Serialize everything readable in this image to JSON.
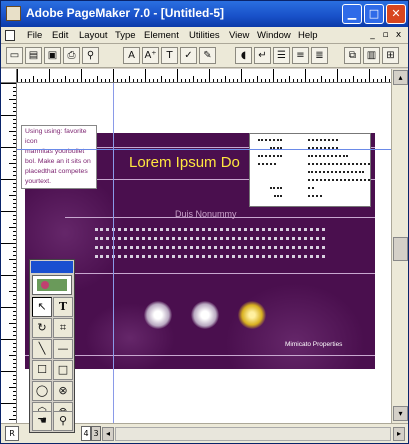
{
  "window": {
    "title": "Adobe PageMaker 7.0 - [Untitled-5]",
    "minimize_glyph": "▁",
    "maximize_glyph": "□",
    "close_glyph": "✕"
  },
  "menu": {
    "items": [
      "File",
      "Edit",
      "Layout",
      "Type",
      "Element",
      "Utilities",
      "View",
      "Window",
      "Help"
    ],
    "mdi": {
      "minimize": "_",
      "restore": "▫",
      "close": "x"
    }
  },
  "toolbar": {
    "buttons": [
      {
        "name": "new-icon",
        "glyph": "▭"
      },
      {
        "name": "open-icon",
        "glyph": "▤"
      },
      {
        "name": "save-icon",
        "glyph": "▣"
      },
      {
        "name": "print-icon",
        "glyph": "⎙"
      },
      {
        "name": "find-icon",
        "glyph": "⚲"
      },
      {
        "name": "char-spec-icon",
        "glyph": "A"
      },
      {
        "name": "font-size-up-icon",
        "glyph": "A⁺"
      },
      {
        "name": "kerning-icon",
        "glyph": "T"
      },
      {
        "name": "spell-check-icon",
        "glyph": "✓"
      },
      {
        "name": "edit-icon",
        "glyph": "✎"
      },
      {
        "name": "para-icon",
        "glyph": "◖"
      },
      {
        "name": "indents-icon",
        "glyph": "↵"
      },
      {
        "name": "bullets-icon",
        "glyph": "☰"
      },
      {
        "name": "list-icon",
        "glyph": "≡"
      },
      {
        "name": "align-icon",
        "glyph": "≣"
      },
      {
        "name": "copy-icon",
        "glyph": "⧉"
      },
      {
        "name": "paste-icon",
        "glyph": "▥"
      },
      {
        "name": "insert-icon",
        "glyph": "⊞"
      }
    ]
  },
  "document": {
    "textbox_lines": [
      "Using using: favorite icon",
      "marmitas yourbullet",
      "bol. Make an it sits on",
      "placedthat competes",
      "yourtext."
    ],
    "headline": "Lorem Ipsum Do",
    "subhead": "Duis Nonummy",
    "footer_label": "Mimicato Properties"
  },
  "bottombar": {
    "pages": [
      "R",
      "4",
      "3"
    ],
    "scroll_left": "◂",
    "scroll_right": "▸"
  },
  "vscroll": {
    "up": "▴",
    "down": "▾"
  },
  "toolbox": {
    "tools": [
      {
        "name": "pointer-tool",
        "glyph": "↖"
      },
      {
        "name": "text-tool",
        "glyph": "T"
      },
      {
        "name": "rotate-tool",
        "glyph": "↻"
      },
      {
        "name": "crop-tool",
        "glyph": "⌗"
      },
      {
        "name": "line-tool",
        "glyph": "╲"
      },
      {
        "name": "constrained-line-tool",
        "glyph": "—"
      },
      {
        "name": "rectangle-frame-tool",
        "glyph": "☐"
      },
      {
        "name": "rectangle-tool",
        "glyph": "□"
      },
      {
        "name": "ellipse-frame-tool",
        "glyph": "◯"
      },
      {
        "name": "ellipse-x-tool",
        "glyph": "⊗"
      },
      {
        "name": "polygon-frame-tool",
        "glyph": "⬡"
      },
      {
        "name": "polygon-x-tool",
        "glyph": "⊗"
      },
      {
        "name": "hand-tool",
        "glyph": "☚"
      },
      {
        "name": "zoom-tool",
        "glyph": "⚲"
      }
    ]
  }
}
